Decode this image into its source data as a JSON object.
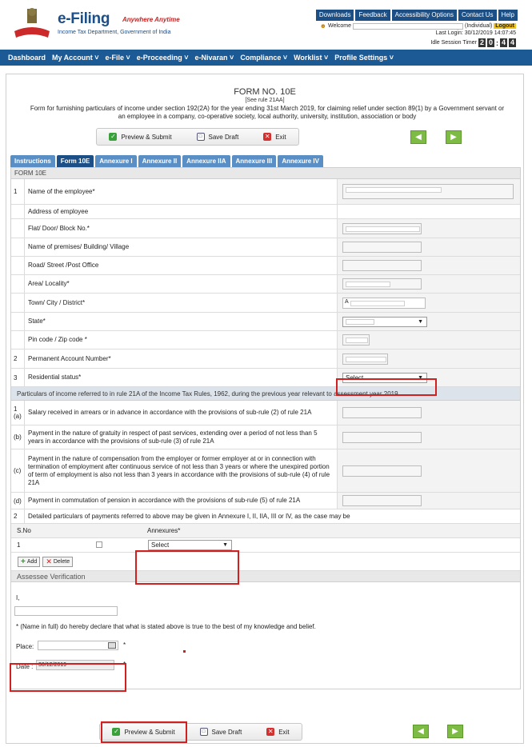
{
  "header": {
    "logo_title": "e-Filing",
    "logo_tagline": "Anywhere Anytime",
    "logo_subtitle": "Income Tax Department, Government of India",
    "top_nav": [
      "Downloads",
      "Feedback",
      "Accessibility Options",
      "Contact Us",
      "Help"
    ],
    "welcome_label": "Welcome",
    "user_type": "(Individual)",
    "logout_label": "Logout",
    "last_login": "Last Login: 30/12/2019 14:07:45",
    "timer_label": "Idle Session Timer",
    "timer_digits": [
      "2",
      "0",
      "4",
      "4"
    ]
  },
  "main_menu": [
    "Dashboard",
    "My Account",
    "e-File",
    "e-Proceeding",
    "e-Nivaran",
    "Compliance",
    "Worklist",
    "Profile Settings"
  ],
  "form": {
    "title": "FORM NO. 10E",
    "rule": "[See rule 21AA]",
    "description": "Form for furnishing particulars of income under section 192(2A) for the year ending 31st March 2019, for claiming relief under section 89(1) by a Government servant or an employee in a company, co-operative society, local authority, university, institution, association or body",
    "toolbar": {
      "preview": "Preview & Submit",
      "save": "Save Draft",
      "exit": "Exit"
    }
  },
  "tabs": [
    "Instructions",
    "Form 10E",
    "Annexure I",
    "Annexure II",
    "Annexure IIA",
    "Annexure III",
    "Annexure IV"
  ],
  "section1": {
    "title": "FORM 10E",
    "rows": [
      {
        "num": "1",
        "label": "Name of the employee*"
      },
      {
        "num": "",
        "label": "Address of employee"
      },
      {
        "num": "",
        "label": "Flat/ Door/ Block No.*"
      },
      {
        "num": "",
        "label": "Name of premises/ Building/ Village"
      },
      {
        "num": "",
        "label": "Road/ Street /Post Office"
      },
      {
        "num": "",
        "label": "Area/ Locality*"
      },
      {
        "num": "",
        "label": "Town/ City / District*"
      },
      {
        "num": "",
        "label": "State*"
      },
      {
        "num": "",
        "label": "Pin code / Zip code *"
      },
      {
        "num": "2",
        "label": "Permanent Account Number*"
      },
      {
        "num": "3",
        "label": "Residential status*"
      }
    ],
    "town_prefix": "A",
    "residential_select": "Select"
  },
  "section2": {
    "title": "Particulars of income referred to in rule 21A of the Income Tax Rules, 1962, during the previous year relevant to assessment year 2019",
    "rows": [
      {
        "num": "1 (a)",
        "label": "Salary received in arrears or in advance in accordance with the provisions of sub-rule (2) of rule 21A"
      },
      {
        "num": "(b)",
        "label": "Payment in the nature of gratuity in respect of past services, extending over a period of not less than 5 years in accordance with the provisions of sub-rule (3) of rule 21A"
      },
      {
        "num": "(c)",
        "label": "Payment in the nature of compensation from the employer or former employer at or in connection with termination of employment after continuous service of not less than 3 years or where the unexpired portion of term of employment is also not less than 3 years in accordance with the provisions of sub-rule (4) of rule 21A"
      },
      {
        "num": "(d)",
        "label": "Payment in commutation of pension in accordance with the provisions of sub-rule (5) of rule 21A"
      },
      {
        "num": "2",
        "label": "Detailed particulars of payments referred to above may be given in Annexure I, II, IIA, III or IV, as the case may be"
      }
    ]
  },
  "annexure": {
    "sno_header": "S.No",
    "annex_header": "Annexures*",
    "row_num": "1",
    "select_value": "Select",
    "add_label": "Add",
    "delete_label": "Delete"
  },
  "verification": {
    "title": "Assessee Verification",
    "i_label": "I,",
    "declaration": "* (Name in full) do hereby declare that what is stated above is true to the best of my knowledge and belief.",
    "place_label": "Place:",
    "date_label": "Date :",
    "date_value": "30/12/2019",
    "asterisk": "*"
  },
  "bottom_toolbar": {
    "preview": "Preview & Submit",
    "save": "Save Draft",
    "exit": "Exit"
  }
}
